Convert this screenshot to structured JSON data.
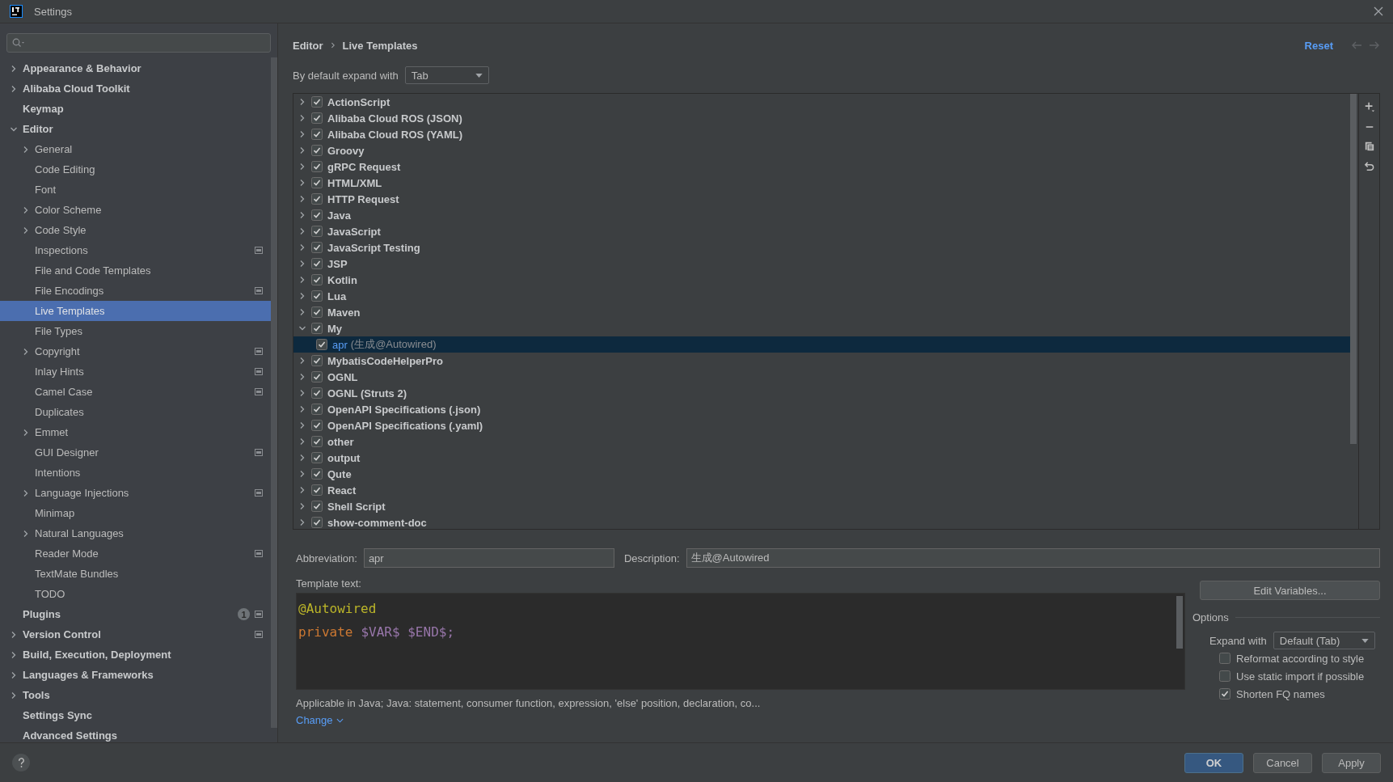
{
  "window": {
    "title": "Settings"
  },
  "sidebar": {
    "items": [
      {
        "label": "Appearance & Behavior",
        "kind": "group",
        "expanded": false,
        "project": false
      },
      {
        "label": "Alibaba Cloud Toolkit",
        "kind": "group",
        "expanded": false,
        "project": false
      },
      {
        "label": "Keymap",
        "kind": "leaf",
        "project": false
      },
      {
        "label": "Editor",
        "kind": "group",
        "expanded": true,
        "project": false,
        "children": [
          {
            "label": "General",
            "kind": "group",
            "expanded": false,
            "project": false,
            "selected": false
          },
          {
            "label": "Code Editing",
            "kind": "leaf",
            "project": false,
            "selected": false
          },
          {
            "label": "Font",
            "kind": "leaf",
            "project": false,
            "selected": false
          },
          {
            "label": "Color Scheme",
            "kind": "group",
            "expanded": false,
            "project": false,
            "selected": false
          },
          {
            "label": "Code Style",
            "kind": "group",
            "expanded": false,
            "project": false,
            "selected": false
          },
          {
            "label": "Inspections",
            "kind": "leaf",
            "project": true,
            "selected": false
          },
          {
            "label": "File and Code Templates",
            "kind": "leaf",
            "project": false,
            "selected": false
          },
          {
            "label": "File Encodings",
            "kind": "leaf",
            "project": true,
            "selected": false
          },
          {
            "label": "Live Templates",
            "kind": "leaf",
            "project": false,
            "selected": true
          },
          {
            "label": "File Types",
            "kind": "leaf",
            "project": false,
            "selected": false
          },
          {
            "label": "Copyright",
            "kind": "group",
            "expanded": false,
            "project": true,
            "selected": false
          },
          {
            "label": "Inlay Hints",
            "kind": "leaf",
            "project": true,
            "selected": false
          },
          {
            "label": "Camel Case",
            "kind": "leaf",
            "project": true,
            "selected": false
          },
          {
            "label": "Duplicates",
            "kind": "leaf",
            "project": false,
            "selected": false
          },
          {
            "label": "Emmet",
            "kind": "group",
            "expanded": false,
            "project": false,
            "selected": false
          },
          {
            "label": "GUI Designer",
            "kind": "leaf",
            "project": true,
            "selected": false
          },
          {
            "label": "Intentions",
            "kind": "leaf",
            "project": false,
            "selected": false
          },
          {
            "label": "Language Injections",
            "kind": "group",
            "expanded": false,
            "project": true,
            "selected": false
          },
          {
            "label": "Minimap",
            "kind": "leaf",
            "project": false,
            "selected": false
          },
          {
            "label": "Natural Languages",
            "kind": "group",
            "expanded": false,
            "project": false,
            "selected": false
          },
          {
            "label": "Reader Mode",
            "kind": "leaf",
            "project": true,
            "selected": false
          },
          {
            "label": "TextMate Bundles",
            "kind": "leaf",
            "project": false,
            "selected": false
          },
          {
            "label": "TODO",
            "kind": "leaf",
            "project": false,
            "selected": false
          }
        ]
      },
      {
        "label": "Plugins",
        "kind": "leaf",
        "project": true,
        "badge": "1"
      },
      {
        "label": "Version Control",
        "kind": "group",
        "expanded": false,
        "project": true
      },
      {
        "label": "Build, Execution, Deployment",
        "kind": "group",
        "expanded": false,
        "project": false
      },
      {
        "label": "Languages & Frameworks",
        "kind": "group",
        "expanded": false,
        "project": false
      },
      {
        "label": "Tools",
        "kind": "group",
        "expanded": false,
        "project": false
      },
      {
        "label": "Settings Sync",
        "kind": "leaf",
        "project": false
      },
      {
        "label": "Advanced Settings",
        "kind": "leaf",
        "project": false
      }
    ]
  },
  "breadcrumb": [
    "Editor",
    "Live Templates"
  ],
  "header_actions": {
    "reset": "Reset"
  },
  "expand_default": {
    "label": "By default expand with",
    "value": "Tab"
  },
  "templates": [
    {
      "name": "ActionScript",
      "checked": true,
      "expanded": false
    },
    {
      "name": "Alibaba Cloud ROS (JSON)",
      "checked": true,
      "expanded": false
    },
    {
      "name": "Alibaba Cloud ROS (YAML)",
      "checked": true,
      "expanded": false
    },
    {
      "name": "Groovy",
      "checked": true,
      "expanded": false
    },
    {
      "name": "gRPC Request",
      "checked": true,
      "expanded": false
    },
    {
      "name": "HTML/XML",
      "checked": true,
      "expanded": false
    },
    {
      "name": "HTTP Request",
      "checked": true,
      "expanded": false
    },
    {
      "name": "Java",
      "checked": true,
      "expanded": false
    },
    {
      "name": "JavaScript",
      "checked": true,
      "expanded": false
    },
    {
      "name": "JavaScript Testing",
      "checked": true,
      "expanded": false
    },
    {
      "name": "JSP",
      "checked": true,
      "expanded": false
    },
    {
      "name": "Kotlin",
      "checked": true,
      "expanded": false
    },
    {
      "name": "Lua",
      "checked": true,
      "expanded": false
    },
    {
      "name": "Maven",
      "checked": true,
      "expanded": false
    },
    {
      "name": "My",
      "checked": true,
      "expanded": true,
      "children": [
        {
          "name": "apr",
          "description": "(生成@Autowired)",
          "checked": true,
          "selected": true
        }
      ]
    },
    {
      "name": "MybatisCodeHelperPro",
      "checked": true,
      "expanded": false
    },
    {
      "name": "OGNL",
      "checked": true,
      "expanded": false
    },
    {
      "name": "OGNL (Struts 2)",
      "checked": true,
      "expanded": false
    },
    {
      "name": "OpenAPI Specifications (.json)",
      "checked": true,
      "expanded": false
    },
    {
      "name": "OpenAPI Specifications (.yaml)",
      "checked": true,
      "expanded": false
    },
    {
      "name": "other",
      "checked": true,
      "expanded": false
    },
    {
      "name": "output",
      "checked": true,
      "expanded": false
    },
    {
      "name": "Qute",
      "checked": true,
      "expanded": false
    },
    {
      "name": "React",
      "checked": true,
      "expanded": false
    },
    {
      "name": "Shell Script",
      "checked": true,
      "expanded": false
    },
    {
      "name": "show-comment-doc",
      "checked": true,
      "expanded": false
    }
  ],
  "abbreviation": {
    "label": "Abbreviation:",
    "value": "apr"
  },
  "description": {
    "label": "Description:",
    "value": "生成@Autowired"
  },
  "template_text": {
    "label": "Template text:",
    "lines": [
      [
        {
          "kind": "annotation",
          "text": "@Autowired"
        }
      ],
      [
        {
          "kind": "keyword",
          "text": "private"
        },
        {
          "kind": "variable",
          "text": "$VAR$ $END$;"
        }
      ]
    ]
  },
  "edit_variables": "Edit Variables...",
  "options": {
    "title": "Options",
    "expand_label": "Expand with",
    "expand_value": "Default (Tab)",
    "checkboxes": [
      {
        "label": "Reformat according to style",
        "checked": false
      },
      {
        "label": "Use static import if possible",
        "checked": false
      },
      {
        "label": "Shorten FQ names",
        "checked": true
      }
    ]
  },
  "applicable": "Applicable in Java; Java: statement, consumer function, expression, 'else' position, declaration, co...",
  "change_link": "Change",
  "buttons": [
    {
      "label": "OK",
      "kind": "primary"
    },
    {
      "label": "Cancel",
      "kind": "normal"
    },
    {
      "label": "Apply",
      "kind": "normal"
    }
  ]
}
